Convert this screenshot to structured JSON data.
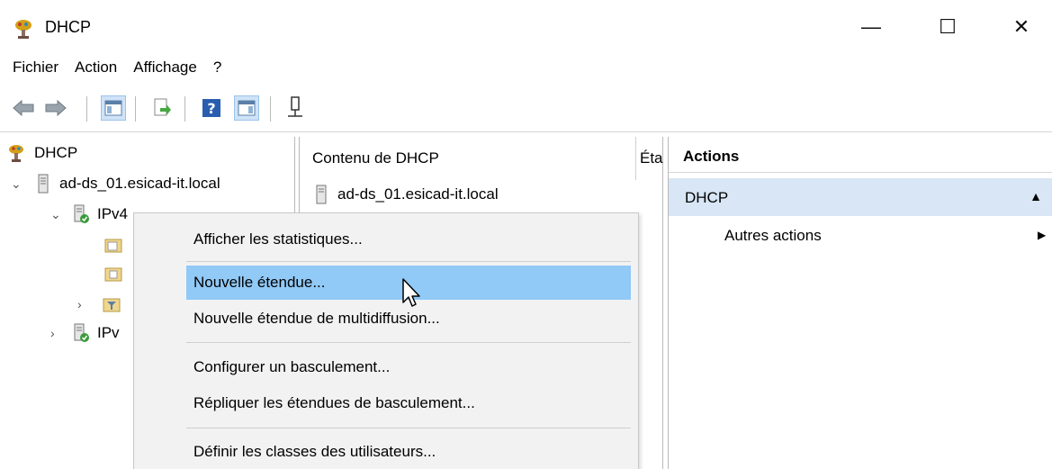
{
  "window": {
    "title": "DHCP",
    "minimize_glyph": "—",
    "maximize_glyph": "☐",
    "close_glyph": "✕"
  },
  "menu": [
    "Fichier",
    "Action",
    "Affichage",
    "?"
  ],
  "toolbar": {
    "icons": [
      "back-arrow-icon",
      "forward-arrow-icon",
      "show-hide-tree-icon",
      "export-list-icon",
      "help-icon",
      "show-hide-action-pane-icon",
      "server-icon"
    ]
  },
  "tree": {
    "root": "DHCP",
    "server": "ad-ds_01.esicad-it.local",
    "ipv4": "IPv4",
    "ipv6": "IPv"
  },
  "content": {
    "header_name": "Contenu de DHCP",
    "header_status": "Éta",
    "row_server": "ad-ds_01.esicad-it.local"
  },
  "actions": {
    "header": "Actions",
    "section": "DHCP",
    "item": "Autres actions"
  },
  "context_menu": {
    "items": [
      "Afficher les statistiques...",
      "Nouvelle étendue...",
      "Nouvelle étendue de multidiffusion...",
      "Configurer un basculement...",
      "Répliquer les étendues de basculement...",
      "Définir les classes des utilisateurs..."
    ],
    "highlighted_index": 1
  },
  "colors": {
    "highlight": "#91c9f7",
    "section_bg": "#d8e6f5",
    "menu_bg": "#f2f2f2"
  }
}
